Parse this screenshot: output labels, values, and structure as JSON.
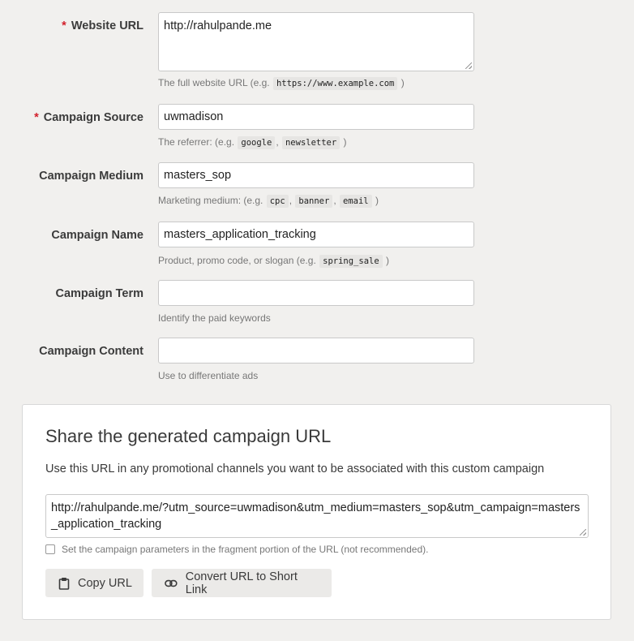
{
  "form": {
    "website_url": {
      "label": "Website URL",
      "required": true,
      "value": "http://rahulpande.me",
      "help_prefix": "The full website URL (e.g.",
      "help_codes": [
        "https://www.example.com"
      ],
      "help_suffix": ")"
    },
    "campaign_source": {
      "label": "Campaign Source",
      "required": true,
      "value": "uwmadison",
      "help_prefix": "The referrer: (e.g.",
      "help_codes": [
        "google",
        "newsletter"
      ],
      "help_suffix": ")"
    },
    "campaign_medium": {
      "label": "Campaign Medium",
      "value": "masters_sop",
      "help_prefix": "Marketing medium: (e.g.",
      "help_codes": [
        "cpc",
        "banner",
        "email"
      ],
      "help_suffix": ")"
    },
    "campaign_name": {
      "label": "Campaign Name",
      "value": "masters_application_tracking",
      "help_prefix": "Product, promo code, or slogan (e.g.",
      "help_codes": [
        "spring_sale"
      ],
      "help_suffix": ")"
    },
    "campaign_term": {
      "label": "Campaign Term",
      "value": "",
      "help": "Identify the paid keywords"
    },
    "campaign_content": {
      "label": "Campaign Content",
      "value": "",
      "help": "Use to differentiate ads"
    }
  },
  "share": {
    "title": "Share the generated campaign URL",
    "description": "Use this URL in any promotional channels you want to be associated with this custom campaign",
    "generated_url": "http://rahulpande.me/?utm_source=uwmadison&utm_medium=masters_sop&utm_campaign=masters_application_tracking",
    "fragment_label": "Set the campaign parameters in the fragment portion of the URL (not recommended).",
    "fragment_checked": false,
    "copy_label": "Copy URL",
    "short_link_label": "Convert URL to Short Link"
  },
  "icons": {
    "copy": "clipboard-icon",
    "short_link": "link-icon"
  },
  "colors": {
    "required_asterisk": "#d21f2b",
    "background": "#f1f0ee",
    "panel": "#ffffff"
  }
}
